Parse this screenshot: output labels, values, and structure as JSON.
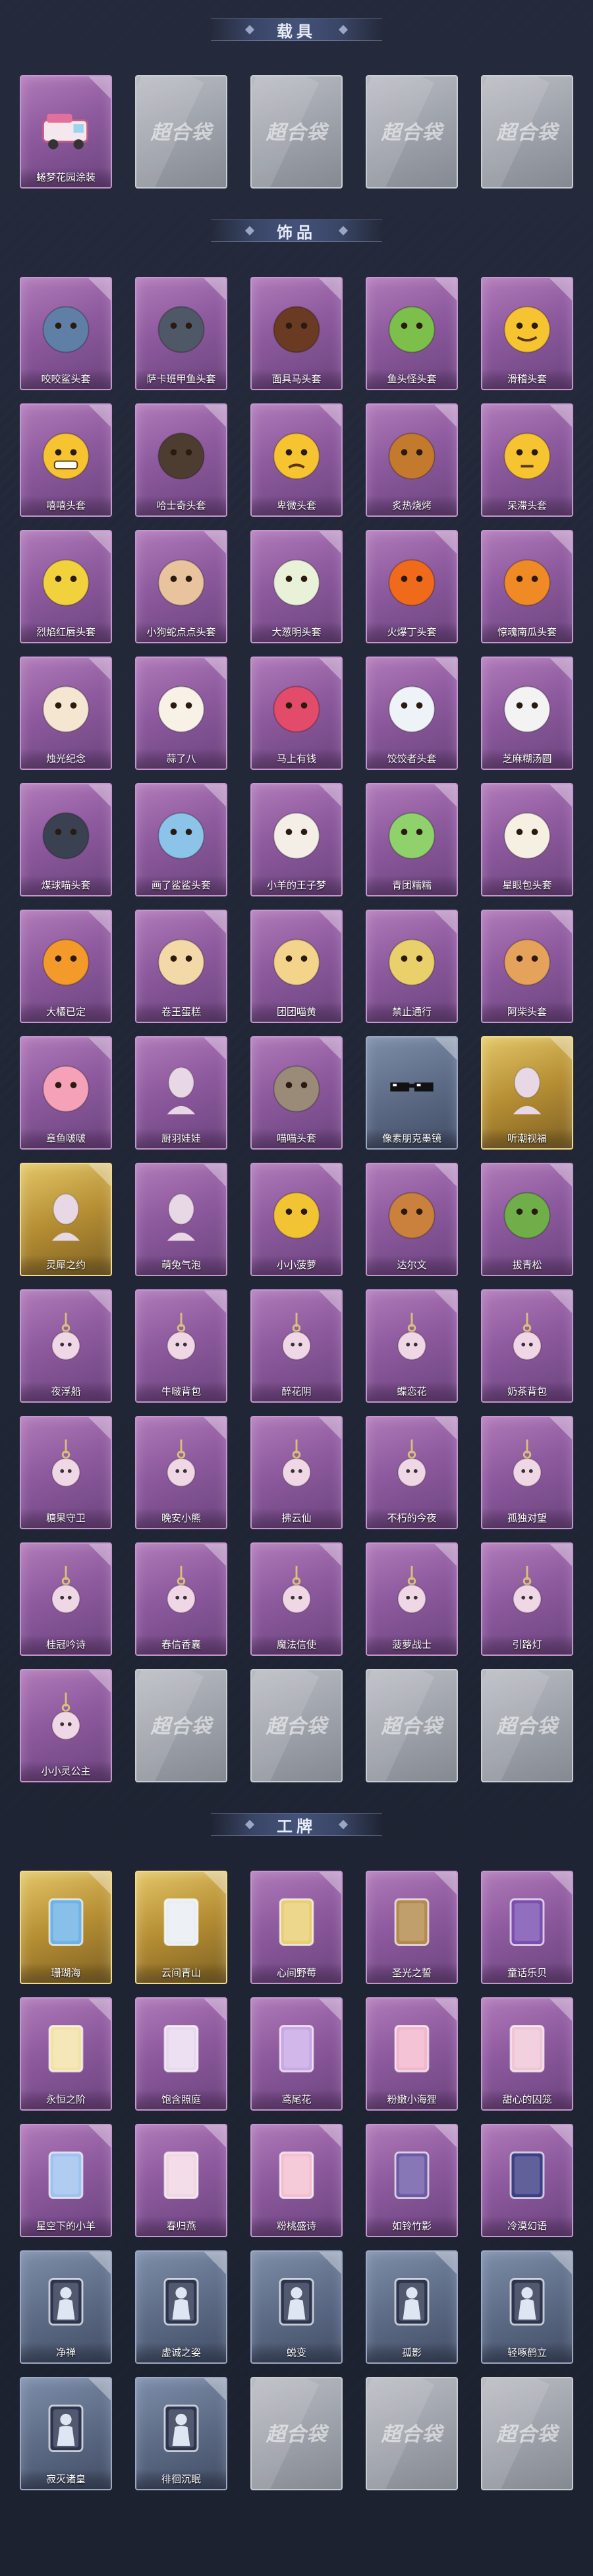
{
  "sections": [
    {
      "title": "载具",
      "items": [
        {
          "name": "蜷梦花园涂装",
          "style": "purple",
          "icon": "ice-cream-truck"
        },
        {
          "name": "",
          "style": "empty",
          "icon": "placeholder"
        },
        {
          "name": "",
          "style": "empty",
          "icon": "placeholder"
        },
        {
          "name": "",
          "style": "empty",
          "icon": "placeholder"
        },
        {
          "name": "",
          "style": "empty",
          "icon": "placeholder"
        }
      ]
    },
    {
      "title": "饰品",
      "items": [
        {
          "name": "咬咬鲨头套",
          "style": "purple",
          "icon": "shark-head"
        },
        {
          "name": "萨卡班甲鱼头套",
          "style": "purple",
          "icon": "fish-head"
        },
        {
          "name": "面具马头套",
          "style": "purple",
          "icon": "horse-head"
        },
        {
          "name": "鱼头怪头套",
          "style": "purple",
          "icon": "fish-monster-head"
        },
        {
          "name": "滑稽头套",
          "style": "purple",
          "icon": "smirk-emoji"
        },
        {
          "name": "嘻嘻头套",
          "style": "purple",
          "icon": "grin-emoji"
        },
        {
          "name": "哈士奇头套",
          "style": "purple",
          "icon": "husky-head"
        },
        {
          "name": "卑微头套",
          "style": "purple",
          "icon": "sad-emoji"
        },
        {
          "name": "炙热烧烤",
          "style": "purple",
          "icon": "toast-head"
        },
        {
          "name": "呆滞头套",
          "style": "purple",
          "icon": "dazed-emoji"
        },
        {
          "name": "烈焰红唇头套",
          "style": "purple",
          "icon": "pikachu-lips"
        },
        {
          "name": "小狗蛇点点头套",
          "style": "purple",
          "icon": "snake-head"
        },
        {
          "name": "大葱明头套",
          "style": "purple",
          "icon": "bok-choy-head"
        },
        {
          "name": "火爆丁头套",
          "style": "purple",
          "icon": "fire-head"
        },
        {
          "name": "惊魂南瓜头套",
          "style": "purple",
          "icon": "pumpkin-head"
        },
        {
          "name": "烛光纪念",
          "style": "purple",
          "icon": "candle-head"
        },
        {
          "name": "蒜了八",
          "style": "purple",
          "icon": "garlic-head"
        },
        {
          "name": "马上有钱",
          "style": "purple",
          "icon": "bird-head"
        },
        {
          "name": "饺饺者头套",
          "style": "purple",
          "icon": "dumpling-head"
        },
        {
          "name": "芝麻糊汤圆",
          "style": "purple",
          "icon": "rice-ball-head"
        },
        {
          "name": "煤球喵头套",
          "style": "purple",
          "icon": "black-cat-head"
        },
        {
          "name": "画了鲨鲨头套",
          "style": "purple",
          "icon": "blue-shark-head"
        },
        {
          "name": "小羊的王子梦",
          "style": "purple",
          "icon": "sheep-head"
        },
        {
          "name": "青团糯糯",
          "style": "purple",
          "icon": "green-ball-head"
        },
        {
          "name": "星眼包头套",
          "style": "purple",
          "icon": "bun-head"
        },
        {
          "name": "大橘已定",
          "style": "purple",
          "icon": "orange-head"
        },
        {
          "name": "卷王蛋糕",
          "style": "purple",
          "icon": "cake-roll-head"
        },
        {
          "name": "团团喵黄",
          "style": "purple",
          "icon": "yellow-cat-head"
        },
        {
          "name": "禁止通行",
          "style": "purple",
          "icon": "barrier-head"
        },
        {
          "name": "阿柴头套",
          "style": "purple",
          "icon": "shiba-head"
        },
        {
          "name": "章鱼啵啵",
          "style": "purple",
          "icon": "octopus-head"
        },
        {
          "name": "厨羽娃娃",
          "style": "purple",
          "icon": "blank-mannequin"
        },
        {
          "name": "喵喵头套",
          "style": "purple",
          "icon": "cat-photo-head"
        },
        {
          "name": "像素朋克墨镜",
          "style": "steel",
          "icon": "pixel-sunglasses"
        },
        {
          "name": "听潮视福",
          "style": "gold",
          "icon": "mannequin"
        },
        {
          "name": "灵犀之约",
          "style": "gold",
          "icon": "mannequin"
        },
        {
          "name": "萌兔气泡",
          "style": "purple",
          "icon": "mannequin"
        },
        {
          "name": "小小菠萝",
          "style": "purple",
          "icon": "pineapple-pet"
        },
        {
          "name": "达尔文",
          "style": "purple",
          "icon": "deer-pet"
        },
        {
          "name": "拔青松",
          "style": "purple",
          "icon": "pine-pet"
        },
        {
          "name": "夜浮船",
          "style": "purple",
          "icon": "ghost-boat-pendant"
        },
        {
          "name": "牛啵背包",
          "style": "purple",
          "icon": "backpack-pendant"
        },
        {
          "name": "醉花阴",
          "style": "purple",
          "icon": "lantern-pendant"
        },
        {
          "name": "蝶恋花",
          "style": "purple",
          "icon": "wreath-pendant"
        },
        {
          "name": "奶茶背包",
          "style": "purple",
          "icon": "qr-pendant"
        },
        {
          "name": "糖果守卫",
          "style": "purple",
          "icon": "candy-pendant"
        },
        {
          "name": "晚安小熊",
          "style": "purple",
          "icon": "bear-pendant"
        },
        {
          "name": "拂云仙",
          "style": "purple",
          "icon": "cloud-pendant"
        },
        {
          "name": "不朽的今夜",
          "style": "purple",
          "icon": "pink-pendant"
        },
        {
          "name": "孤独对望",
          "style": "purple",
          "icon": "doll-pendant"
        },
        {
          "name": "桂冠吟诗",
          "style": "purple",
          "icon": "laurel-pendant"
        },
        {
          "name": "春信香囊",
          "style": "purple",
          "icon": "sachet-pendant"
        },
        {
          "name": "魔法信使",
          "style": "purple",
          "icon": "mouse-pendant"
        },
        {
          "name": "菠萝战士",
          "style": "purple",
          "icon": "warrior-pendant"
        },
        {
          "name": "引路灯",
          "style": "purple",
          "icon": "lamp-pendant"
        },
        {
          "name": "小小灵公主",
          "style": "purple",
          "icon": "princess-pendant"
        },
        {
          "name": "",
          "style": "empty",
          "icon": "placeholder"
        },
        {
          "name": "",
          "style": "empty",
          "icon": "placeholder"
        },
        {
          "name": "",
          "style": "empty",
          "icon": "placeholder"
        },
        {
          "name": "",
          "style": "empty",
          "icon": "placeholder"
        }
      ]
    },
    {
      "title": "工牌",
      "items": [
        {
          "name": "珊瑚海",
          "style": "gold",
          "icon": "badge-blue"
        },
        {
          "name": "云间青山",
          "style": "gold",
          "icon": "badge-white"
        },
        {
          "name": "心间野莓",
          "style": "purple",
          "icon": "badge-gold"
        },
        {
          "name": "圣光之誓",
          "style": "purple",
          "icon": "badge-bronze"
        },
        {
          "name": "童话乐贝",
          "style": "purple",
          "icon": "badge-violet"
        },
        {
          "name": "永恒之阶",
          "style": "purple",
          "icon": "badge-bell"
        },
        {
          "name": "饱含照庭",
          "style": "purple",
          "icon": "badge-castle"
        },
        {
          "name": "鸢尾花",
          "style": "purple",
          "icon": "badge-lilac"
        },
        {
          "name": "粉嫩小海狸",
          "style": "purple",
          "icon": "badge-pink"
        },
        {
          "name": "甜心的囚笼",
          "style": "purple",
          "icon": "badge-rose"
        },
        {
          "name": "星空下的小羊",
          "style": "purple",
          "icon": "badge-star"
        },
        {
          "name": "春归燕",
          "style": "purple",
          "icon": "badge-swallow"
        },
        {
          "name": "粉桃盛诗",
          "style": "purple",
          "icon": "badge-peach"
        },
        {
          "name": "如铃竹影",
          "style": "purple",
          "icon": "badge-lotus"
        },
        {
          "name": "冷漠幻语",
          "style": "purple",
          "icon": "badge-night"
        },
        {
          "name": "净禅",
          "style": "steel",
          "icon": "silhouette-pose"
        },
        {
          "name": "虚诚之姿",
          "style": "steel",
          "icon": "silhouette-pose"
        },
        {
          "name": "蜕变",
          "style": "steel",
          "icon": "silhouette-pose"
        },
        {
          "name": "孤影",
          "style": "steel",
          "icon": "silhouette-pose"
        },
        {
          "name": "轻啄鹤立",
          "style": "steel",
          "icon": "silhouette-pose"
        },
        {
          "name": "寂灭诸皇",
          "style": "steel",
          "icon": "silhouette-pose"
        },
        {
          "name": "徘徊沉眠",
          "style": "steel",
          "icon": "silhouette-pose"
        },
        {
          "name": "",
          "style": "empty",
          "icon": "placeholder"
        },
        {
          "name": "",
          "style": "empty",
          "icon": "placeholder"
        },
        {
          "name": "",
          "style": "empty",
          "icon": "placeholder"
        }
      ]
    }
  ],
  "placeholder_text": "超合袋"
}
